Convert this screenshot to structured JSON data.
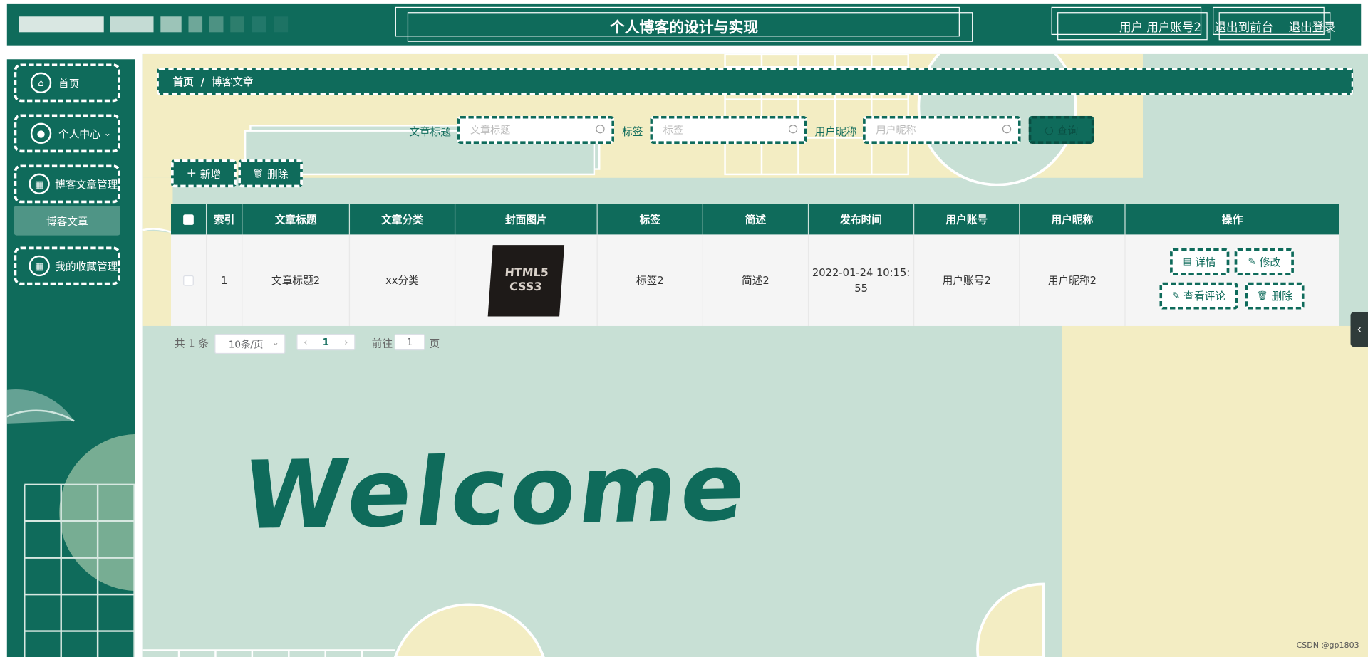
{
  "header": {
    "title": "个人博客的设计与实现",
    "user_text": "用户 用户账号2",
    "exit_front": "退出到前台",
    "logout": "退出登录"
  },
  "sidebar": {
    "items": [
      {
        "label": "首页",
        "icon": "home-icon"
      },
      {
        "label": "个人中心",
        "icon": "user-icon"
      },
      {
        "label": "博客文章管理",
        "icon": "grid-icon"
      },
      {
        "label": "我的收藏管理",
        "icon": "grid-icon"
      }
    ],
    "sub_item": "博客文章"
  },
  "breadcrumb": {
    "home": "首页",
    "sep": "/",
    "current": "博客文章"
  },
  "search": {
    "title_label": "文章标题",
    "title_placeholder": "文章标题",
    "tag_label": "标签",
    "tag_placeholder": "标签",
    "nick_label": "用户昵称",
    "nick_placeholder": "用户昵称",
    "query_button": "查询"
  },
  "actions": {
    "add": "新增",
    "delete": "删除"
  },
  "table": {
    "headers": [
      "索引",
      "文章标题",
      "文章分类",
      "封面图片",
      "标签",
      "简述",
      "发布时间",
      "用户账号",
      "用户昵称",
      "操作"
    ],
    "rows": [
      {
        "index": "1",
        "title": "文章标题2",
        "category": "xx分类",
        "cover_text_1": "HTML5",
        "cover_text_2": "CSS3",
        "tag": "标签2",
        "summary": "简述2",
        "time_1": "2022-01-24 10:15:",
        "time_2": "55",
        "account": "用户账号2",
        "nickname": "用户昵称2",
        "ops": {
          "detail": "详情",
          "edit": "修改",
          "comments": "查看评论",
          "delete": "删除"
        }
      }
    ]
  },
  "pagination": {
    "total": "共 1 条",
    "page_size": "10条/页",
    "current_page": "1",
    "goto_label": "前往",
    "goto_value": "1",
    "page_suffix": "页"
  },
  "welcome": "Welcome",
  "watermark": "CSDN @gp1803",
  "colors": {
    "primary": "#0f6b5b",
    "mint": "#c8e0d5",
    "cream": "#f3edc3"
  }
}
